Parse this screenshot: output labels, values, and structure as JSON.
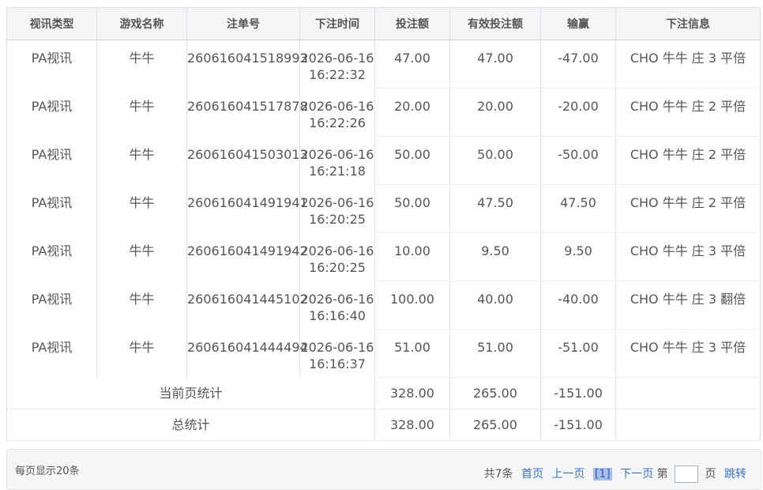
{
  "table": {
    "headers": [
      "视讯类型",
      "游戏名称",
      "注单号",
      "下注时间",
      "投注额",
      "有效投注额",
      "输赢",
      "下注信息"
    ],
    "rows": [
      {
        "type": "PA视讯",
        "game": "牛牛",
        "order": "260616041518993",
        "date": "2026-06-16",
        "time": "16:22:32",
        "bet": "47.00",
        "valid": "47.00",
        "winloss": "-47.00",
        "info": "CHO 牛牛 庄 3 平倍"
      },
      {
        "type": "PA视讯",
        "game": "牛牛",
        "order": "260616041517878",
        "date": "2026-06-16",
        "time": "16:22:26",
        "bet": "20.00",
        "valid": "20.00",
        "winloss": "-20.00",
        "info": "CHO 牛牛 庄 2 平倍"
      },
      {
        "type": "PA视讯",
        "game": "牛牛",
        "order": "260616041503013",
        "date": "2026-06-16",
        "time": "16:21:18",
        "bet": "50.00",
        "valid": "50.00",
        "winloss": "-50.00",
        "info": "CHO 牛牛 庄 2 平倍"
      },
      {
        "type": "PA视讯",
        "game": "牛牛",
        "order": "260616041491941",
        "date": "2026-06-16",
        "time": "16:20:25",
        "bet": "50.00",
        "valid": "47.50",
        "winloss": "47.50",
        "info": "CHO 牛牛 庄 2 平倍"
      },
      {
        "type": "PA视讯",
        "game": "牛牛",
        "order": "260616041491942",
        "date": "2026-06-16",
        "time": "16:20:25",
        "bet": "10.00",
        "valid": "9.50",
        "winloss": "9.50",
        "info": "CHO 牛牛 庄 3 平倍"
      },
      {
        "type": "PA视讯",
        "game": "牛牛",
        "order": "260616041445102",
        "date": "2026-06-16",
        "time": "16:16:40",
        "bet": "100.00",
        "valid": "40.00",
        "winloss": "-40.00",
        "info": "CHO 牛牛 庄 3 翻倍"
      },
      {
        "type": "PA视讯",
        "game": "牛牛",
        "order": "260616041444494",
        "date": "2026-06-16",
        "time": "16:16:37",
        "bet": "51.00",
        "valid": "51.00",
        "winloss": "-51.00",
        "info": "CHO 牛牛 庄 3 平倍"
      }
    ],
    "page_total": {
      "label": "当前页统计",
      "bet": "328.00",
      "valid": "265.00",
      "winloss": "-151.00"
    },
    "grand_total": {
      "label": "总统计",
      "bet": "328.00",
      "valid": "265.00",
      "winloss": "-151.00"
    }
  },
  "pager": {
    "per_page": "每页显示20条",
    "total": "共7条",
    "first": "首页",
    "prev": "上一页",
    "current": "[1]",
    "next": "下一页",
    "goto_prefix": "第",
    "goto_suffix": "页",
    "jump": "跳转"
  }
}
